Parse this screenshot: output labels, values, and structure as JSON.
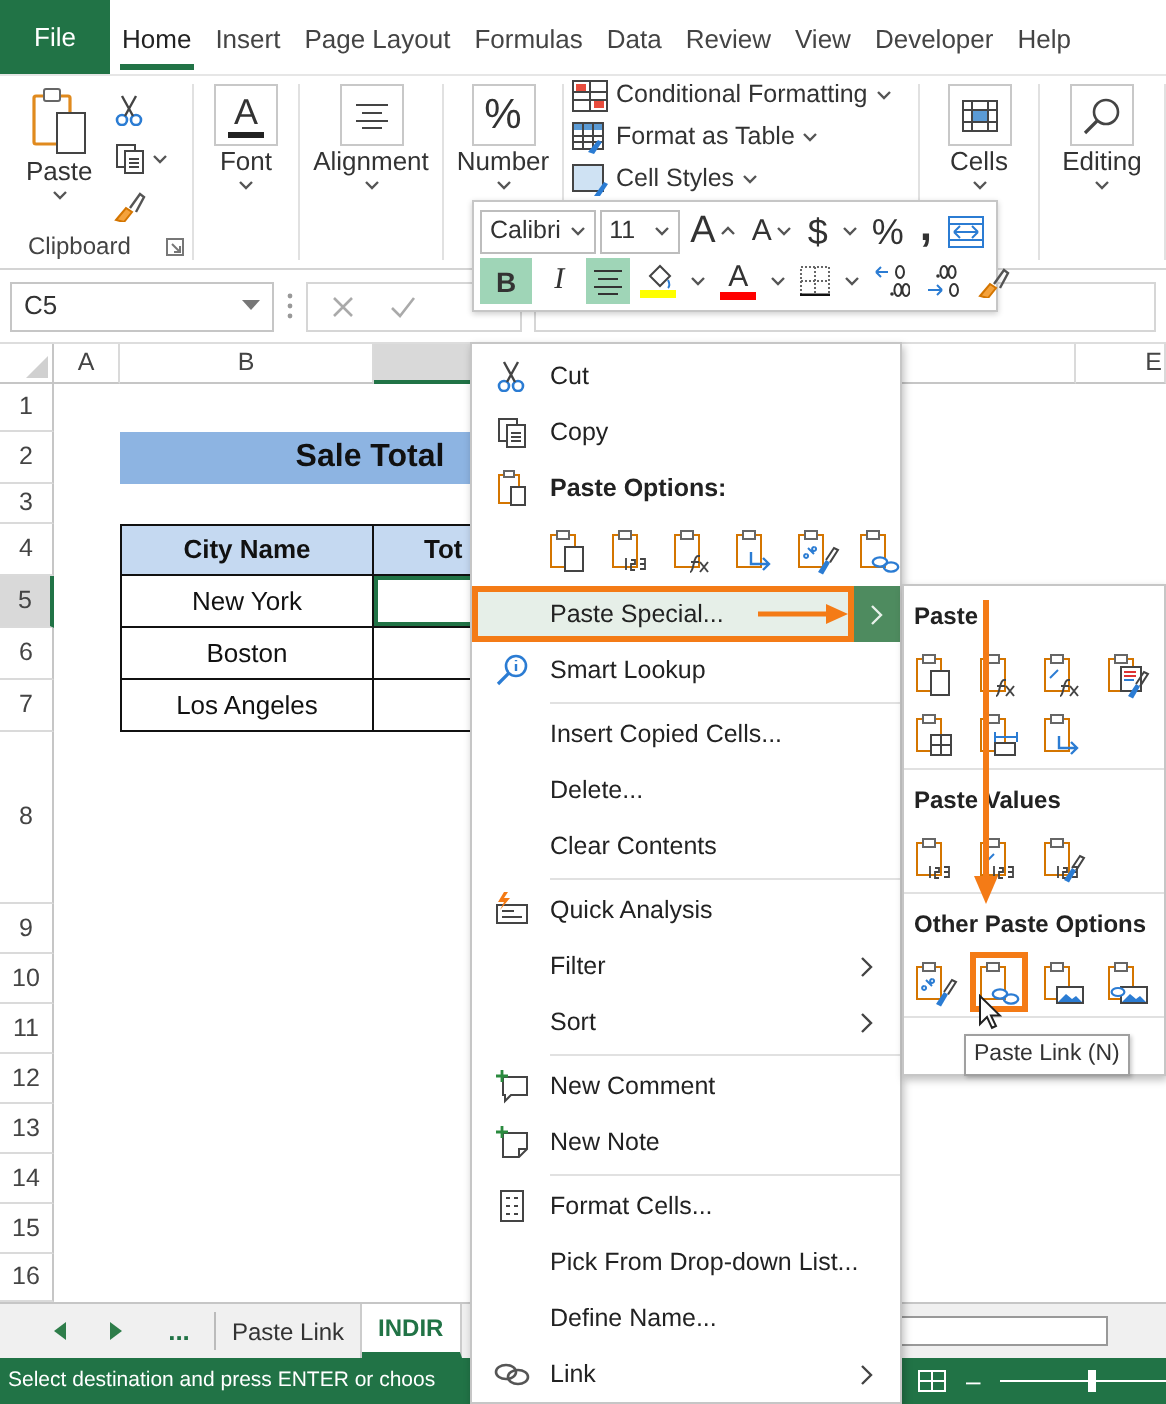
{
  "ribbon_tabs": [
    {
      "label": "File",
      "kind": "file",
      "selected": false
    },
    {
      "label": "Home",
      "kind": "tab",
      "selected": true
    },
    {
      "label": "Insert",
      "kind": "tab",
      "selected": false
    },
    {
      "label": "Page Layout",
      "kind": "tab",
      "selected": false
    },
    {
      "label": "Formulas",
      "kind": "tab",
      "selected": false
    },
    {
      "label": "Data",
      "kind": "tab",
      "selected": false
    },
    {
      "label": "Review",
      "kind": "tab",
      "selected": false
    },
    {
      "label": "View",
      "kind": "tab",
      "selected": false
    },
    {
      "label": "Developer",
      "kind": "tab",
      "selected": false
    },
    {
      "label": "Help",
      "kind": "tab",
      "selected": false
    }
  ],
  "clipboard": {
    "paste": "Paste",
    "label": "Clipboard"
  },
  "ribbon_groups": [
    {
      "kind": "font",
      "glyph": "A",
      "label": "Font"
    },
    {
      "kind": "alignment",
      "label": "Alignment"
    },
    {
      "kind": "number",
      "glyph": "%",
      "label": "Number"
    },
    {
      "kind": "styles",
      "items": [
        {
          "kind": "conditional",
          "label": "Conditional Formatting"
        },
        {
          "kind": "table",
          "label": "Format as Table"
        },
        {
          "kind": "cell-styles",
          "label": "Cell Styles"
        }
      ]
    },
    {
      "kind": "cells",
      "label": "Cells"
    },
    {
      "kind": "editing",
      "label": "Editing"
    }
  ],
  "mini_toolbar": {
    "font": "Calibri",
    "size": "11",
    "row_1": [
      {
        "kind": "grow-font",
        "glyph": "A",
        "dropdown": false
      },
      {
        "kind": "shrink-font",
        "glyph": "A",
        "dropdown": false
      },
      {
        "kind": "glyph",
        "glyph": "$",
        "dropdown": true
      },
      {
        "kind": "glyph",
        "glyph": "%",
        "dropdown": false
      },
      {
        "kind": "comma",
        "glyph": ",",
        "dropdown": false
      },
      {
        "kind": "wrap",
        "dropdown": false
      }
    ],
    "row_2": [
      {
        "kind": "bold",
        "glyph": "B",
        "selected": true,
        "dropdown": false
      },
      {
        "kind": "italic",
        "glyph": "I",
        "selected": false,
        "dropdown": false
      },
      {
        "kind": "align-center",
        "selected": true,
        "dropdown": false
      },
      {
        "kind": "fill-color",
        "color": "#ffff00",
        "selected": false,
        "dropdown": true
      },
      {
        "kind": "font-color",
        "glyph": "A",
        "color": "#ff0000",
        "selected": false,
        "dropdown": true
      },
      {
        "kind": "borders",
        "selected": false,
        "dropdown": true
      },
      {
        "kind": "increase-decimal",
        "selected": false,
        "dropdown": false
      },
      {
        "kind": "decrease-decimal",
        "selected": false,
        "dropdown": false
      },
      {
        "kind": "format-painter",
        "selected": false,
        "dropdown": false
      }
    ]
  },
  "formula_bar": {
    "name_box": "C5"
  },
  "sheet": {
    "columns": [
      {
        "label": "A",
        "selected": false
      },
      {
        "label": "B",
        "selected": false
      },
      {
        "selected": true
      },
      {
        "selected": false
      },
      {
        "label": "E",
        "selected": false
      }
    ],
    "rows": [
      {
        "label": "1",
        "selected": false
      },
      {
        "label": "2",
        "selected": false
      },
      {
        "label": "3",
        "selected": false
      },
      {
        "label": "4",
        "selected": false
      },
      {
        "label": "5",
        "selected": true
      },
      {
        "label": "6",
        "selected": false
      },
      {
        "label": "7",
        "selected": false
      },
      {
        "label": "8",
        "selected": false
      },
      {
        "label": "9",
        "selected": false
      },
      {
        "label": "10",
        "selected": false
      },
      {
        "label": "11",
        "selected": false
      },
      {
        "label": "12",
        "selected": false
      },
      {
        "label": "13",
        "selected": false
      },
      {
        "label": "14",
        "selected": false
      },
      {
        "label": "15",
        "selected": false
      },
      {
        "label": "16",
        "selected": false
      }
    ],
    "title": "Sale Total",
    "table_columns": [
      "City Name",
      "Tot"
    ],
    "cities": [
      "New York",
      "Boston",
      "Los Angeles"
    ]
  },
  "context_menu": {
    "items": [
      {
        "kind": "cut",
        "label": "Cut",
        "selected": false,
        "submenu": false
      },
      {
        "kind": "copy",
        "label": "Copy",
        "selected": false,
        "submenu": false
      },
      {
        "kind": "paste-header",
        "label": "Paste Options:"
      },
      {
        "kind": "paste-options",
        "options": [
          {
            "kind": "page"
          },
          {
            "kind": "values"
          },
          {
            "kind": "formula"
          },
          {
            "kind": "transpose"
          },
          {
            "kind": "formatting"
          },
          {
            "kind": "link"
          }
        ]
      },
      {
        "kind": "item",
        "label": "Paste Special...",
        "selected": true,
        "submenu": true,
        "annotated": true
      },
      {
        "kind": "lookup",
        "label": "Smart Lookup",
        "selected": false,
        "submenu": false
      },
      {
        "kind": "separator"
      },
      {
        "kind": "item",
        "label": "Insert Copied Cells...",
        "selected": false,
        "submenu": false
      },
      {
        "kind": "item",
        "label": "Delete...",
        "selected": false,
        "submenu": false
      },
      {
        "kind": "item",
        "label": "Clear Contents",
        "selected": false,
        "submenu": false
      },
      {
        "kind": "separator"
      },
      {
        "kind": "quick-analysis",
        "label": "Quick Analysis",
        "selected": false,
        "submenu": false
      },
      {
        "kind": "item",
        "label": "Filter",
        "selected": false,
        "submenu": true
      },
      {
        "kind": "item",
        "label": "Sort",
        "selected": false,
        "submenu": true
      },
      {
        "kind": "separator"
      },
      {
        "kind": "comment",
        "label": "New Comment",
        "selected": false,
        "submenu": false
      },
      {
        "kind": "note",
        "label": "New Note",
        "selected": false,
        "submenu": false
      },
      {
        "kind": "separator"
      },
      {
        "kind": "format-cells",
        "label": "Format Cells...",
        "selected": false,
        "submenu": false
      },
      {
        "kind": "item",
        "label": "Pick From Drop-down List...",
        "selected": false,
        "submenu": false
      },
      {
        "kind": "item",
        "label": "Define Name...",
        "selected": false,
        "submenu": false
      },
      {
        "kind": "link",
        "label": "Link",
        "selected": false,
        "submenu": true
      }
    ]
  },
  "paste_submenu": {
    "sections": [
      {
        "title": "Paste",
        "options": [
          {
            "kind": "page",
            "annotated": false
          },
          {
            "kind": "formula",
            "annotated": false
          },
          {
            "kind": "formula-format",
            "annotated": false
          },
          {
            "kind": "keep-source",
            "annotated": false
          },
          {
            "kind": "no-borders",
            "annotated": false
          },
          {
            "kind": "column-widths",
            "annotated": false
          },
          {
            "kind": "transpose",
            "annotated": false
          }
        ]
      },
      {
        "title": "Paste Values",
        "options": [
          {
            "kind": "values",
            "annotated": false
          },
          {
            "kind": "values-format",
            "annotated": false
          },
          {
            "kind": "values-source",
            "annotated": false
          }
        ]
      },
      {
        "title": "Other Paste Options",
        "options": [
          {
            "kind": "formatting",
            "annotated": false
          },
          {
            "kind": "link",
            "annotated": true
          },
          {
            "kind": "picture",
            "annotated": false
          },
          {
            "kind": "linked-picture",
            "annotated": false
          }
        ]
      }
    ]
  },
  "tooltip": "Paste Link (N)",
  "sheet_tabs": {
    "more": "...",
    "tabs": [
      {
        "label": "Paste Link",
        "selected": false
      },
      {
        "label": "INDIR",
        "selected": true
      }
    ]
  },
  "status_bar": {
    "message": "Select destination and press ENTER or choos",
    "zoom_out": "–",
    "zoom": {
      "level": 0.55
    }
  }
}
